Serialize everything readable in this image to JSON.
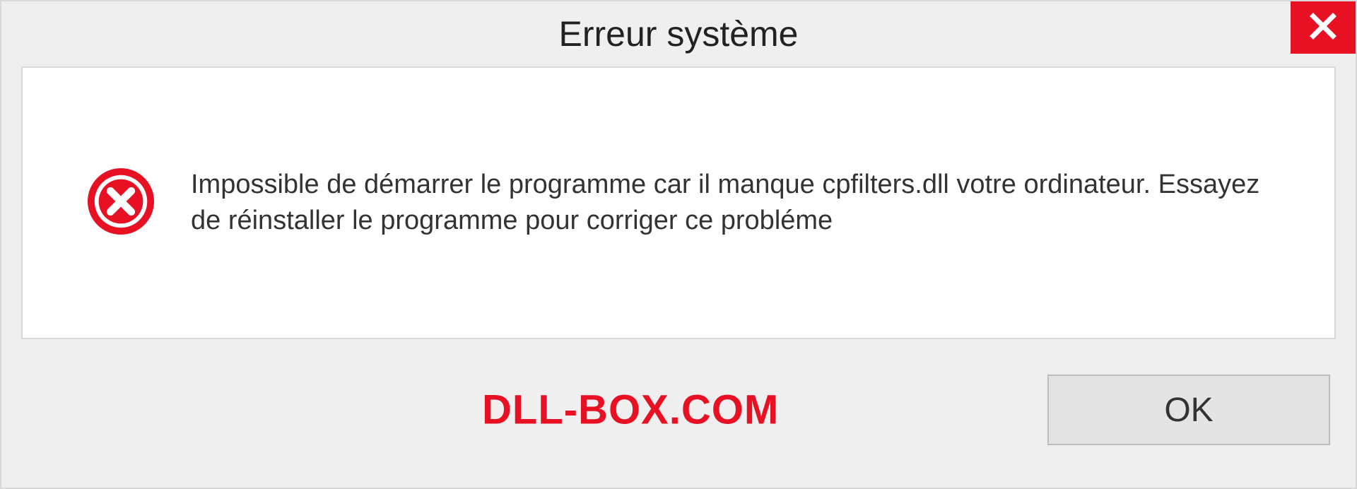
{
  "dialog": {
    "title": "Erreur système",
    "message": "Impossible de démarrer le programme car il manque cpfilters.dll votre ordinateur. Essayez de réinstaller le programme pour corriger ce probléme",
    "brand": "DLL-BOX.COM",
    "ok_label": "OK"
  },
  "colors": {
    "accent_red": "#e81123",
    "panel_bg": "#efefef"
  }
}
